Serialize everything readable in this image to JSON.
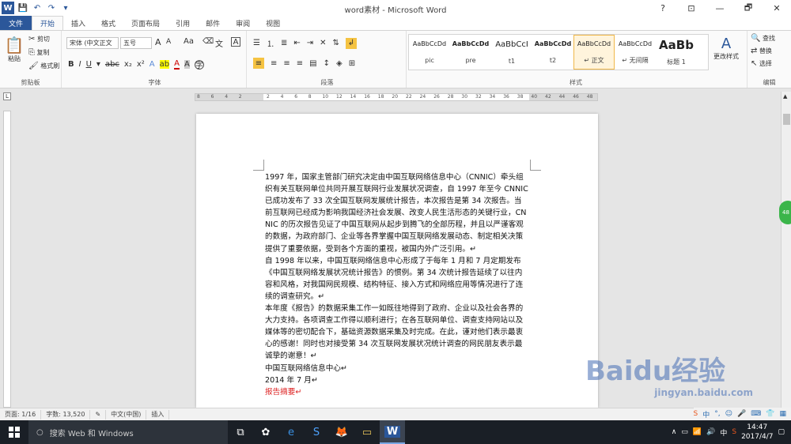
{
  "window": {
    "title": "word素材 - Microsoft Word",
    "min": "—",
    "restore": "🗗",
    "close": "✕"
  },
  "tabs": [
    {
      "label": "文件"
    },
    {
      "label": "开始"
    },
    {
      "label": "插入"
    },
    {
      "label": "格式"
    },
    {
      "label": "页面布局"
    },
    {
      "label": "引用"
    },
    {
      "label": "邮件"
    },
    {
      "label": "审阅"
    },
    {
      "label": "视图"
    }
  ],
  "clipboard": {
    "paste": "粘贴",
    "cut": "剪切",
    "copy": "复制",
    "format_painter": "格式刷",
    "group": "剪贴板"
  },
  "font": {
    "name": "宋体 (中文正文",
    "size": "五号",
    "grow": "A",
    "shrink": "A",
    "change_case": "Aa",
    "group": "字体"
  },
  "paragraph": {
    "group": "段落"
  },
  "styles": {
    "group": "样式",
    "items": [
      {
        "preview": "AaBbCcDd",
        "name": "pic"
      },
      {
        "preview": "AaBbCcDd",
        "name": "pre"
      },
      {
        "preview": "AaBbCcI",
        "name": "t1"
      },
      {
        "preview": "AaBbCcDd",
        "name": "t2"
      },
      {
        "preview": "AaBbCcDd",
        "name": "↵ 正文"
      },
      {
        "preview": "AaBbCcDd",
        "name": "↵ 无间隔"
      },
      {
        "preview": "AaBb",
        "name": "标题 1"
      }
    ],
    "change_styles": "更改样式"
  },
  "editing": {
    "find": "查找",
    "replace": "替换",
    "select": "选择",
    "group": "编辑"
  },
  "ruler": {
    "ticks": [
      "8",
      "6",
      "4",
      "2",
      "",
      "2",
      "4",
      "6",
      "8",
      "10",
      "12",
      "14",
      "16",
      "18",
      "20",
      "22",
      "24",
      "26",
      "28",
      "30",
      "32",
      "34",
      "36",
      "38",
      "40",
      "42",
      "44",
      "46",
      "48"
    ]
  },
  "document": {
    "paragraphs": [
      "1997 年，国家主管部门研究决定由中国互联网络信息中心（CNNIC）牵头组织有关互联网单位共同开展互联网行业发展状况调查，自 1997 年至今 CNNIC 已成功发布了 33 次全国互联网发展统计报告，本次报告是第 34 次报告。当前互联网已经成为影响我国经济社会发展、改变人民生活形态的关键行业，CNNIC 的历次报告见证了中国互联网从起步到腾飞的全部历程，并且以严谨客观的数据，为政府部门、企业等各界掌握中国互联网络发展动态、制定相关决策提供了重要依据，受到各个方面的重视，被国内外广泛引用。↵",
      "自 1998 年以来，中国互联网络信息中心形成了于每年 1 月和 7 月定期发布《中国互联网络发展状况统计报告》的惯例。第 34 次统计报告延续了以往内容和风格，对我国网民规模、结构特征、接入方式和网络应用等情况进行了连续的调查研究。↵",
      "本年度《报告》的数据采集工作一如既往地得到了政府、企业以及社会各界的大力支持。各项调查工作得以顺利进行；在各互联网单位、调查支持网站以及媒体等的密切配合下，基础资源数据采集及时完成。在此，谨对他们表示最衷心的感谢！同时也对接受第 34 次互联网发展状况统计调查的网民朋友表示最诚挚的谢意！↵",
      "中国互联网络信息中心↵",
      "2014 年 7 月↵",
      "报告摘要↵"
    ]
  },
  "side_badge": "48",
  "statusbar": {
    "page": "页面: 1/16",
    "words": "字数: 13,520",
    "lang": "中文(中国)",
    "mode": "插入"
  },
  "watermark": {
    "brand": "Baidu经验",
    "url": "jingyan.baidu.com"
  },
  "taskbar": {
    "search": "搜索 Web 和 Windows",
    "time": "14:47",
    "date": "2017/4/7",
    "ime": "中"
  },
  "colors": {
    "accent": "#2b579a",
    "report_heading": "#dd2222",
    "style_selected": "#f0b84a"
  }
}
